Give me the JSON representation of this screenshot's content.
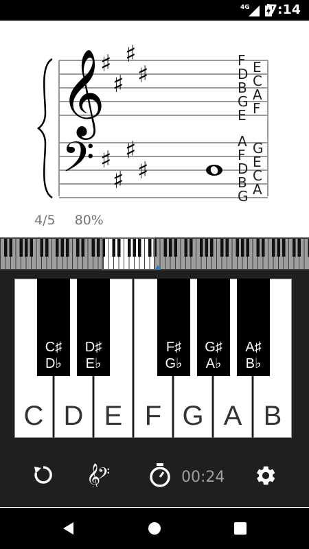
{
  "status_bar": {
    "network": "4G",
    "time": "7:14"
  },
  "staff": {
    "treble_labels_left": [
      "F",
      "D",
      "B",
      "G",
      "E"
    ],
    "treble_labels_right": [
      "E",
      "C",
      "A",
      "F"
    ],
    "bass_labels_left": [
      "A",
      "F",
      "D",
      "B",
      "G"
    ],
    "bass_labels_right": [
      "G",
      "E",
      "C",
      "A"
    ]
  },
  "progress": {
    "count": "4/5",
    "percent": "80%"
  },
  "keyboard": {
    "white_keys": [
      "C",
      "D",
      "E",
      "F",
      "G",
      "A",
      "B"
    ],
    "black_keys": [
      {
        "sharp": "C♯",
        "flat": "D♭"
      },
      {
        "sharp": "D♯",
        "flat": "E♭"
      },
      {
        "sharp": "F♯",
        "flat": "G♭"
      },
      {
        "sharp": "G♯",
        "flat": "A♭"
      },
      {
        "sharp": "A♯",
        "flat": "B♭"
      }
    ]
  },
  "toolbar": {
    "icons": [
      "replay-icon",
      "clefs-icon",
      "stopwatch-icon",
      "settings-icon"
    ],
    "timer": "00:24"
  },
  "nav": {
    "icons": [
      "back-icon",
      "home-icon",
      "recents-icon"
    ]
  }
}
